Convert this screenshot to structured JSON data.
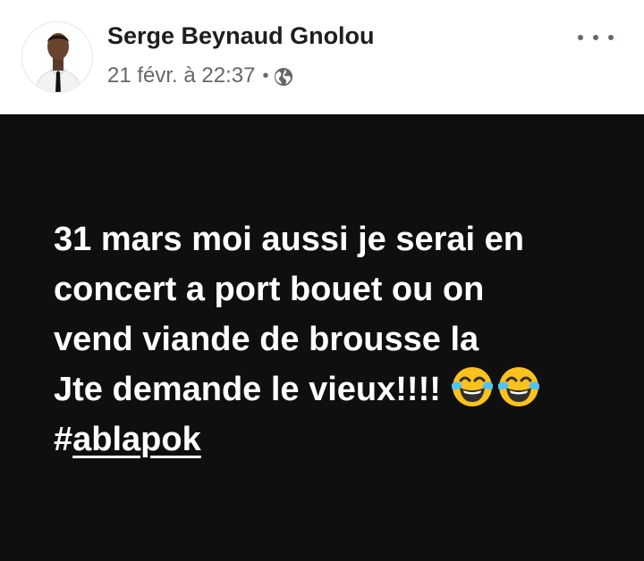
{
  "post": {
    "author": "Serge Beynaud Gnolou",
    "timestamp": "21 févr. à 22:37",
    "separator": "•",
    "privacy_icon": "globe-icon",
    "more_icon": "more-options-icon",
    "lines": [
      "31 mars moi aussi je serai en",
      "concert a port bouet ou on",
      "vend viande de brousse la",
      "Jte demande le vieux!!!!"
    ],
    "emojis": [
      "face-with-tears-of-joy",
      "face-with-tears-of-joy"
    ],
    "hashtag_symbol": "#",
    "hashtag_text": "ablapok",
    "colors": {
      "background": "#0f0f10",
      "text": "#ffffff",
      "author": "#1c1e21",
      "meta": "#65676b"
    }
  }
}
